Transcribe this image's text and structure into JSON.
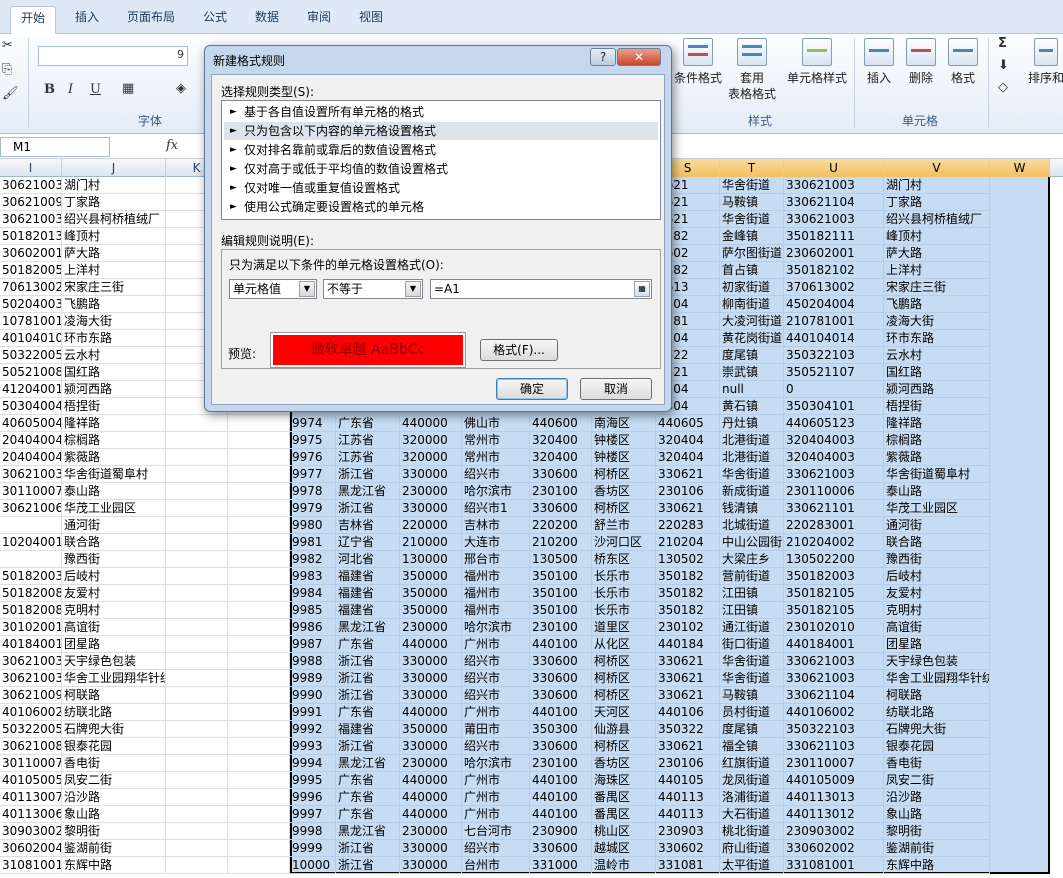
{
  "tabs": [
    "开始",
    "插入",
    "页面布局",
    "公式",
    "数据",
    "审阅",
    "视图"
  ],
  "ribbon": {
    "font_group": "字体",
    "style_group": "样式",
    "cell_group": "单元格",
    "cond_format": "条件格式",
    "table_format_1": "套用",
    "table_format_2": "表格格式",
    "cell_style": "单元格样式",
    "insert": "插入",
    "delete": "删除",
    "format": "格式",
    "sort": "排序和",
    "bold": "B",
    "italic": "I",
    "underline": "U",
    "sigma": "Σ",
    "font_size_hint": "9"
  },
  "namebox": "M1",
  "fx": "fx",
  "columns": [
    "I",
    "J",
    "K",
    "S",
    "T",
    "U",
    "V",
    "W"
  ],
  "rows": [
    [
      "30621003",
      "湖门村",
      "",
      "0621",
      "华舍街道",
      "330621003",
      "湖门村"
    ],
    [
      "30621009",
      "丁家路",
      "",
      "0621",
      "马鞍镇",
      "330621104",
      "丁家路"
    ],
    [
      "30621003",
      "绍兴县柯桥植绒厂",
      "",
      "0621",
      "华舍街道",
      "330621003",
      "绍兴县柯桥植绒厂"
    ],
    [
      "50182013",
      "峰顶村",
      "",
      "0182",
      "金峰镇",
      "350182111",
      "峰顶村"
    ],
    [
      "30602001",
      "萨大路",
      "",
      "0602",
      "萨尔图街道",
      "230602001",
      "萨大路"
    ],
    [
      "50182005",
      "上洋村",
      "",
      "0182",
      "首占镇",
      "350182102",
      "上洋村"
    ],
    [
      "70613002",
      "宋家庄三街",
      "",
      "0613",
      "初家街道",
      "370613002",
      "宋家庄三街"
    ],
    [
      "50204003",
      "飞鹏路",
      "",
      "0204",
      "柳南街道",
      "450204004",
      "飞鹏路"
    ],
    [
      "10781001",
      "凌海大街",
      "",
      "0781",
      "大凌河街道",
      "210781001",
      "凌海大街"
    ],
    [
      "40104010",
      "环市东路",
      "",
      "0104",
      "黄花岗街道",
      "440104014",
      "环市东路"
    ],
    [
      "50322005",
      "云水村",
      "",
      "0322",
      "度尾镇",
      "350322103",
      "云水村"
    ],
    [
      "50521008",
      "国红路",
      "",
      "0521",
      "崇武镇",
      "350521107",
      "国红路"
    ],
    [
      "41204001",
      "颍河西路",
      "",
      "1204",
      "null",
      "0",
      "颍河西路"
    ],
    [
      "50304004",
      "梧捏街",
      "",
      "0304",
      "黄石镇",
      "350304101",
      "梧捏街"
    ],
    [
      "40605004",
      "隆祥路",
      "9974",
      "广东省",
      "440000",
      "佛山市",
      "440600",
      "南海区",
      "440605",
      "丹灶镇",
      "440605123",
      "隆祥路"
    ],
    [
      "20404004",
      "棕榈路",
      "9975",
      "江苏省",
      "320000",
      "常州市",
      "320400",
      "钟楼区",
      "320404",
      "北港街道",
      "320404003",
      "棕榈路"
    ],
    [
      "20404004",
      "紫薇路",
      "9976",
      "江苏省",
      "320000",
      "常州市",
      "320400",
      "钟楼区",
      "320404",
      "北港街道",
      "320404003",
      "紫薇路"
    ],
    [
      "30621003",
      "华舍街道蜀阜村",
      "9977",
      "浙江省",
      "330000",
      "绍兴市",
      "330600",
      "柯桥区",
      "330621",
      "华舍街道",
      "330621003",
      "华舍街道蜀阜村"
    ],
    [
      "30110007",
      "泰山路",
      "9978",
      "黑龙江省",
      "230000",
      "哈尔滨市",
      "230100",
      "香坊区",
      "230106",
      "新成街道",
      "230110006",
      "泰山路"
    ],
    [
      "30621006",
      "华茂工业园区",
      "9979",
      "浙江省",
      "330000",
      "绍兴市1",
      "330600",
      "柯桥区",
      "330621",
      "钱清镇",
      "330621101",
      "华茂工业园区"
    ],
    [
      "",
      "通河街",
      "9980",
      "吉林省",
      "220000",
      "吉林市",
      "220200",
      "舒兰市",
      "220283",
      "北城街道",
      "220283001",
      "通河街"
    ],
    [
      "10204001",
      "联合路",
      "9981",
      "辽宁省",
      "210000",
      "大连市",
      "210200",
      "沙河口区",
      "210204",
      "中山公园街",
      "210204002",
      "联合路"
    ],
    [
      "",
      "豫西街",
      "9982",
      "河北省",
      "130000",
      "邢台市",
      "130500",
      "桥东区",
      "130502",
      "大梁庄乡",
      "130502200",
      "豫西街"
    ],
    [
      "50182003",
      "后岐村",
      "9983",
      "福建省",
      "350000",
      "福州市",
      "350100",
      "长乐市",
      "350182",
      "营前街道",
      "350182003",
      "后岐村"
    ],
    [
      "50182008",
      "友爱村",
      "9984",
      "福建省",
      "350000",
      "福州市",
      "350100",
      "长乐市",
      "350182",
      "江田镇",
      "350182105",
      "友爱村"
    ],
    [
      "50182008",
      "克明村",
      "9985",
      "福建省",
      "350000",
      "福州市",
      "350100",
      "长乐市",
      "350182",
      "江田镇",
      "350182105",
      "克明村"
    ],
    [
      "30102001",
      "高谊街",
      "9986",
      "黑龙江省",
      "230000",
      "哈尔滨市",
      "230100",
      "道里区",
      "230102",
      "通江街道",
      "230102010",
      "高谊街"
    ],
    [
      "40184001",
      "团星路",
      "9987",
      "广东省",
      "440000",
      "广州市",
      "440100",
      "从化区",
      "440184",
      "街口街道",
      "440184001",
      "团星路"
    ],
    [
      "30621003",
      "天宇绿色包装",
      "9988",
      "浙江省",
      "330000",
      "绍兴市",
      "330600",
      "柯桥区",
      "330621",
      "华舍街道",
      "330621003",
      "天宇绿色包装"
    ],
    [
      "30621003",
      "华舍工业园翔华针纺",
      "9989",
      "浙江省",
      "330000",
      "绍兴市",
      "330600",
      "柯桥区",
      "330621",
      "华舍街道",
      "330621003",
      "华舍工业园翔华针纺"
    ],
    [
      "30621009",
      "柯联路",
      "9990",
      "浙江省",
      "330000",
      "绍兴市",
      "330600",
      "柯桥区",
      "330621",
      "马鞍镇",
      "330621104",
      "柯联路"
    ],
    [
      "40106002",
      "纺联北路",
      "9991",
      "广东省",
      "440000",
      "广州市",
      "440100",
      "天河区",
      "440106",
      "员村街道",
      "440106002",
      "纺联北路"
    ],
    [
      "50322005",
      "石牌兜大街",
      "9992",
      "福建省",
      "350000",
      "莆田市",
      "350300",
      "仙游县",
      "350322",
      "度尾镇",
      "350322103",
      "石牌兜大街"
    ],
    [
      "30621008",
      "银泰花园",
      "9993",
      "浙江省",
      "330000",
      "绍兴市",
      "330600",
      "柯桥区",
      "330621",
      "福全镇",
      "330621103",
      "银泰花园"
    ],
    [
      "30110007",
      "香电街",
      "9994",
      "黑龙江省",
      "230000",
      "哈尔滨市",
      "230100",
      "香坊区",
      "230106",
      "红旗街道",
      "230110007",
      "香电街"
    ],
    [
      "40105005",
      "凤安二街",
      "9995",
      "广东省",
      "440000",
      "广州市",
      "440100",
      "海珠区",
      "440105",
      "龙凤街道",
      "440105009",
      "凤安二街"
    ],
    [
      "40113007",
      "沿沙路",
      "9996",
      "广东省",
      "440000",
      "广州市",
      "440100",
      "番禺区",
      "440113",
      "洛浦街道",
      "440113013",
      "沿沙路"
    ],
    [
      "40113006",
      "象山路",
      "9997",
      "广东省",
      "440000",
      "广州市",
      "440100",
      "番禺区",
      "440113",
      "大石街道",
      "440113012",
      "象山路"
    ],
    [
      "30903002",
      "黎明街",
      "9998",
      "黑龙江省",
      "230000",
      "七台河市",
      "230900",
      "桃山区",
      "230903",
      "桃北街道",
      "230903002",
      "黎明街"
    ],
    [
      "30602004",
      "鉴湖前街",
      "9999",
      "浙江省",
      "330000",
      "绍兴市",
      "330600",
      "越城区",
      "330602",
      "府山街道",
      "330602002",
      "鉴湖前街"
    ],
    [
      "31081001",
      "东辉中路",
      "10000",
      "浙江省",
      "330000",
      "台州市",
      "331000",
      "温岭市",
      "331081",
      "太平街道",
      "331081001",
      "东辉中路"
    ]
  ],
  "dialog": {
    "title": "新建格式规则",
    "help": "?",
    "close": "✕",
    "select_type_label": "选择规则类型(S):",
    "rule_types": [
      "基于各自值设置所有单元格的格式",
      "只为包含以下内容的单元格设置格式",
      "仅对排名靠前或靠后的数值设置格式",
      "仅对高于或低于平均值的数值设置格式",
      "仅对唯一值或重复值设置格式",
      "使用公式确定要设置格式的单元格"
    ],
    "edit_label": "编辑规则说明(E):",
    "condition_label": "只为满足以下条件的单元格设置格式(O):",
    "cond_type": "单元格值",
    "operator": "不等于",
    "value": "=A1",
    "preview_label": "预览:",
    "preview_text": "微软卓越  AaBbCc",
    "format_btn": "格式(F)...",
    "ok": "确定",
    "cancel": "取消"
  }
}
